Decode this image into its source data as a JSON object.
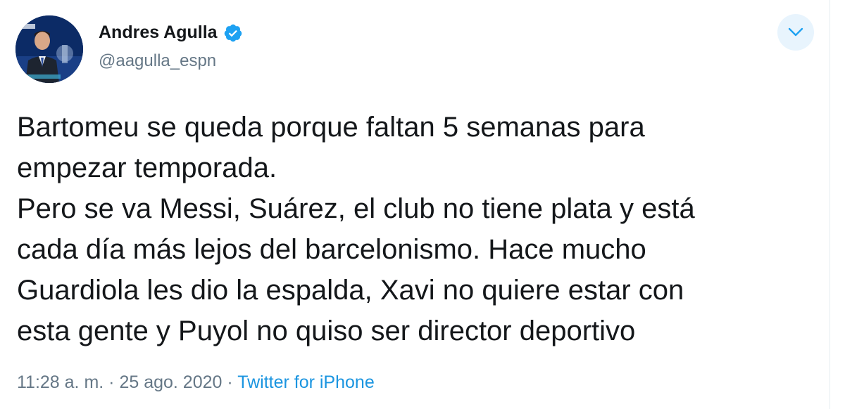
{
  "author": {
    "name": "Andres Agulla",
    "handle": "@aagulla_espn"
  },
  "tweet": {
    "lines": [
      "Bartomeu se queda porque faltan 5 semanas para",
      "empezar temporada.",
      "Pero se va Messi, Suárez, el club no tiene plata y está",
      "cada día más lejos del barcelonismo. Hace mucho",
      "Guardiola les dio la espalda, Xavi no quiere estar con",
      "esta gente y Puyol no quiso ser director deportivo"
    ]
  },
  "meta": {
    "time": "11:28 a. m.",
    "separator": " · ",
    "date": "25 ago. 2020",
    "separator2": " · ",
    "source": "Twitter for iPhone"
  },
  "icons": {
    "verified": "verified-badge-icon",
    "menu": "chevron-down-icon"
  },
  "colors": {
    "accent": "#1da1f2",
    "link": "#1b95e0",
    "secondary_text": "#657786",
    "caret_bg": "#e8f4fd"
  }
}
